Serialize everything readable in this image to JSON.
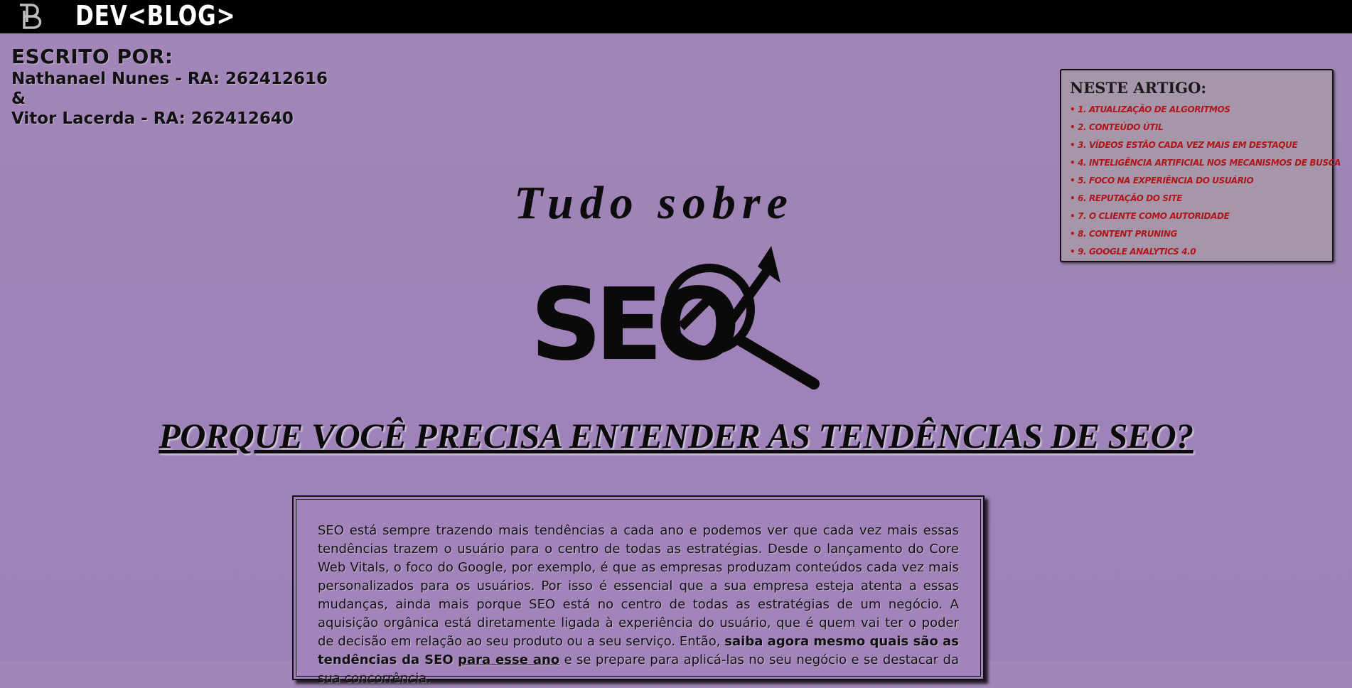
{
  "header": {
    "brand": "DEV<BLOG>",
    "logo_icon": "db-monogram-icon"
  },
  "authors": {
    "heading": "ESCRITO POR:",
    "author1": "Nathanael Nunes - RA: 262412616",
    "separator": "&",
    "author2": "Vitor Lacerda - RA: 262412640"
  },
  "toc": {
    "title": "NESTE ARTIGO:",
    "items": [
      {
        "label": "1. ATUALIZAÇÃO DE ALGORITMOS"
      },
      {
        "label": "2. CONTEÚDO ÚTIL"
      },
      {
        "label": "3. VÍDEOS ESTÃO CADA VEZ MAIS EM DESTAQUE"
      },
      {
        "label": "4. INTELIGÊNCIA ARTIFICIAL NOS MECANISMOS DE BUSCA"
      },
      {
        "label": "5. FOCO NA EXPERIÊNCIA DO USUÁRIO"
      },
      {
        "label": "6. REPUTAÇÃO DO SITE"
      },
      {
        "label": "7. O CLIENTE COMO AUTORIDADE"
      },
      {
        "label": "8. CONTENT PRUNING"
      },
      {
        "label": "9. GOOGLE ANALYTICS 4.0"
      }
    ]
  },
  "hero": {
    "title": "Tudo sobre",
    "logo_text": "SEO",
    "logo_icon": "magnifier-trend-arrow-icon"
  },
  "headline": "PORQUE VOCÊ PRECISA ENTENDER AS TENDÊNCIAS DE SEO?",
  "article": {
    "text_before": "SEO está sempre trazendo mais tendências a cada ano e podemos ver que cada vez mais essas tendências trazem o usuário para o centro de todas as estratégias. Desde o lançamento do Core Web Vitals, o foco do Google, por exemplo, é que as empresas produzam conteúdos cada vez mais personalizados para os usuários. Por isso é essencial que a sua empresa esteja atenta a essas mudanças, ainda mais porque SEO está no centro de todas as estratégias de um negócio. A aquisição orgânica está diretamente ligada à experiência do usuário, que é quem vai ter o poder de decisão em relação ao seu produto ou a seu serviço. Então, ",
    "bold_1": "saiba agora mesmo quais são as tendências da SEO",
    "bold_2": "para esse ano",
    "text_after": " e se prepare para aplicá-las no seu negócio e se destacar da sua concorrência."
  },
  "colors": {
    "background": "#9f83b8",
    "topbar": "#000000",
    "toc_link": "#b0171b",
    "toc_background": "#a696aa"
  }
}
